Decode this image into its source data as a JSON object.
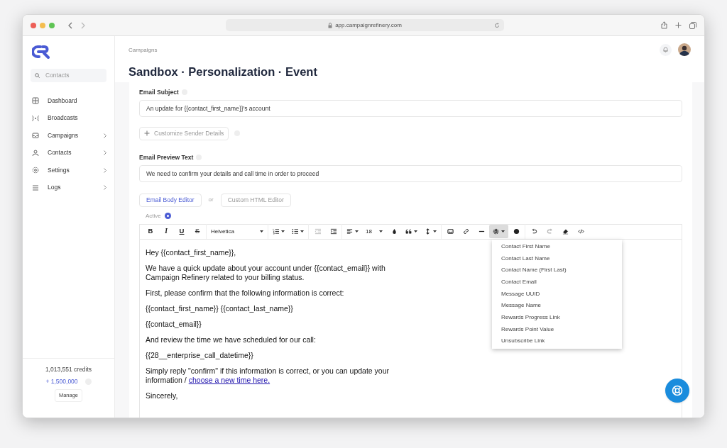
{
  "browser": {
    "address": "app.campaignrefinery.com"
  },
  "sidebar": {
    "search": {
      "placeholder": "Contacts"
    },
    "items": [
      {
        "kind": "grid",
        "label": "Dashboard",
        "has_submenu": false
      },
      {
        "kind": "signal",
        "label": "Broadcasts",
        "has_submenu": false
      },
      {
        "kind": "mail",
        "label": "Campaigns",
        "has_submenu": true
      },
      {
        "kind": "person",
        "label": "Contacts",
        "has_submenu": true
      },
      {
        "kind": "gear",
        "label": "Settings",
        "has_submenu": true
      },
      {
        "kind": "lines",
        "label": "Logs",
        "has_submenu": true
      }
    ],
    "credits": "1,013,551 credits",
    "bonus": "+ 1,500,000",
    "manage": "Manage"
  },
  "header": {
    "breadcrumb": "Campaigns",
    "title": "Sandbox · Personalization · Event"
  },
  "form": {
    "subject_label": "Email Subject",
    "subject": "An update for {{contact_first_name}}'s account",
    "customize": "Customize Sender Details",
    "preview_label": "Email Preview Text",
    "preview": "We need to confirm your details and call time in order to proceed",
    "editor_tabs": [
      {
        "label": "Email Body Editor",
        "selected": true
      },
      {
        "label": "Custom HTML Editor",
        "selected": false
      }
    ],
    "or": "or",
    "status": "Active"
  },
  "toolbar": [
    {
      "kind": "bold",
      "label": "B",
      "disabled": false,
      "active": false
    },
    {
      "kind": "italic",
      "label": "I",
      "disabled": false,
      "active": false
    },
    {
      "kind": "underline",
      "label": "U",
      "disabled": false,
      "active": false
    },
    {
      "kind": "strike",
      "label": "S",
      "disabled": false,
      "active": false
    },
    {
      "kind": "font",
      "label": "Helvetica",
      "disabled": false,
      "active": false
    },
    {
      "kind": "olist",
      "disabled": false,
      "active": false
    },
    {
      "kind": "ulist",
      "disabled": false,
      "active": false
    },
    {
      "kind": "outdent",
      "disabled": true,
      "active": false
    },
    {
      "kind": "indent",
      "disabled": false,
      "active": false
    },
    {
      "kind": "align",
      "disabled": false,
      "active": false
    },
    {
      "kind": "size",
      "label": "18",
      "disabled": false,
      "active": false
    },
    {
      "kind": "color",
      "disabled": false,
      "active": false
    },
    {
      "kind": "quote",
      "disabled": false,
      "active": false
    },
    {
      "kind": "lineheight",
      "disabled": false,
      "active": false
    },
    {
      "kind": "image",
      "disabled": false,
      "active": false
    },
    {
      "kind": "link",
      "disabled": false,
      "active": false
    },
    {
      "kind": "rule",
      "disabled": false,
      "active": false
    },
    {
      "kind": "variables",
      "disabled": false,
      "active": true
    },
    {
      "kind": "emoji",
      "disabled": false,
      "active": false
    },
    {
      "kind": "undo",
      "disabled": false,
      "active": false
    },
    {
      "kind": "redo",
      "disabled": true,
      "active": false
    },
    {
      "kind": "eraser",
      "disabled": false,
      "active": false
    },
    {
      "kind": "code",
      "disabled": false,
      "active": false
    }
  ],
  "body": [
    {
      "lines": [
        "Hey {{contact_first_name}},"
      ]
    },
    {
      "lines": [
        "We have a quick update about your account under {{contact_email}} with",
        "Campaign Refinery related to your billing status."
      ]
    },
    {
      "lines": [
        "First, please confirm that the following information is correct:"
      ]
    },
    {
      "lines": [
        "{{contact_first_name}} {{contact_last_name}}"
      ]
    },
    {
      "lines": [
        "{{contact_email}}"
      ]
    },
    {
      "lines": [
        "And review the time we have scheduled for our call:"
      ]
    },
    {
      "lines": [
        "{{28__enterprise_call_datetime}}"
      ]
    },
    {
      "lines": [
        "Simply reply \"confirm\" if this information is correct, or you can update your",
        "information / "
      ],
      "link": "choose a new time here."
    },
    {
      "lines": [
        "Sincerely,"
      ]
    }
  ],
  "variables_menu": [
    "Contact First Name",
    "Contact Last Name",
    "Contact Name (First Last)",
    "Contact Email",
    "Message UUID",
    "Message Name",
    "Rewards Progress Link",
    "Rewards Point Value",
    "Unsubscribe Link"
  ]
}
